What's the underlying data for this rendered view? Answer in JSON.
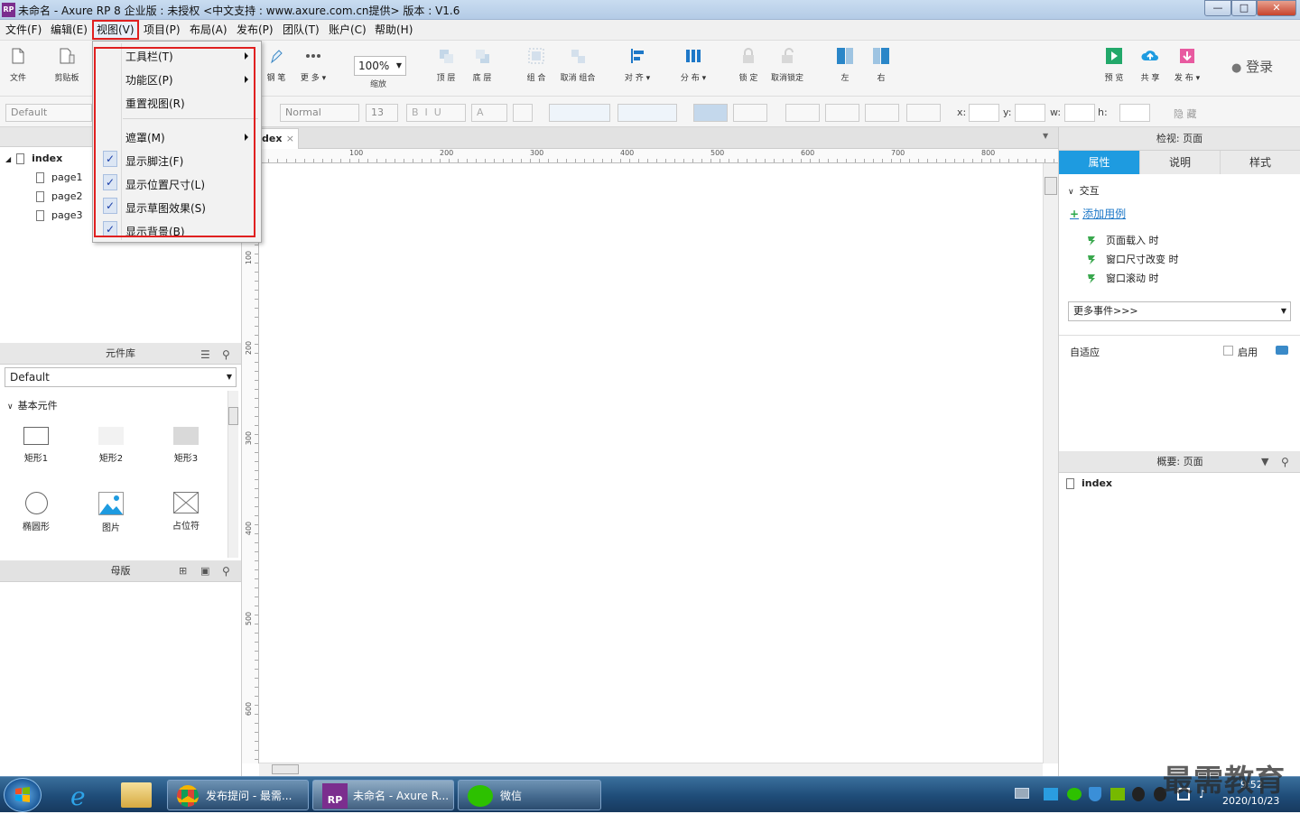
{
  "window": {
    "title": "未命名 - Axure RP 8 企业版 : 未授权      <中文支持 : www.axure.com.cn提供> 版本 : V1.6",
    "app_icon": "RP"
  },
  "menubar": [
    {
      "label": "文件(F)"
    },
    {
      "label": "编辑(E)"
    },
    {
      "label": "视图(V)"
    },
    {
      "label": "项目(P)"
    },
    {
      "label": "布局(A)"
    },
    {
      "label": "发布(P)"
    },
    {
      "label": "团队(T)"
    },
    {
      "label": "账户(C)"
    },
    {
      "label": "帮助(H)"
    }
  ],
  "view_menu": {
    "items": [
      {
        "label": "工具栏(T)",
        "checked": false,
        "submenu": true
      },
      {
        "label": "功能区(P)",
        "checked": false,
        "submenu": true
      },
      {
        "label": "重置视图(R)",
        "checked": false,
        "submenu": false
      },
      {
        "label": "遮罩(M)",
        "checked": false,
        "submenu": true
      },
      {
        "label": "显示脚注(F)",
        "checked": true,
        "submenu": false
      },
      {
        "label": "显示位置尺寸(L)",
        "checked": true,
        "submenu": false
      },
      {
        "label": "显示草图效果(S)",
        "checked": true,
        "submenu": false
      },
      {
        "label": "显示背景(B)",
        "checked": true,
        "submenu": false
      }
    ],
    "check_glyph": "✓"
  },
  "toolbar": {
    "file": "文件",
    "clipboard": "剪贴板",
    "pen": "钢 笔",
    "more": "更 多 ▾",
    "zoom_value": "100%",
    "zoom_label": "缩放",
    "top": "顶 层",
    "bottom": "底 层",
    "group": "组 合",
    "ungroup": "取消 组合",
    "align": "对 齐 ▾",
    "distribute": "分 布 ▾",
    "lock": "锁 定",
    "unlock": "取消锁定",
    "left": "左",
    "right": "右",
    "preview": "预 览",
    "share": "共 享",
    "publish": "发 布 ▾",
    "login": "登录"
  },
  "formatbar": {
    "style": "Default",
    "font_style": "Normal",
    "font_size": "13",
    "x_label": "x:",
    "y_label": "y:",
    "w_label": "w:",
    "h_label": "h:",
    "hide": "隐 藏"
  },
  "pages_panel": {
    "pages": [
      {
        "label": "index"
      },
      {
        "label": "page1"
      },
      {
        "label": "page2"
      },
      {
        "label": "page3"
      }
    ]
  },
  "widgets_panel": {
    "title": "元件库",
    "library": "Default",
    "section": "基本元件",
    "items": [
      {
        "label": "矩形1"
      },
      {
        "label": "矩形2"
      },
      {
        "label": "矩形3"
      },
      {
        "label": "椭圆形"
      },
      {
        "label": "图片"
      },
      {
        "label": "占位符"
      }
    ]
  },
  "masters_panel": {
    "title": "母版"
  },
  "canvas": {
    "tab": "dex",
    "ruler_h": [
      "100",
      "200",
      "300",
      "400",
      "500",
      "600",
      "700",
      "800"
    ],
    "ruler_v": [
      "100",
      "200",
      "300",
      "400",
      "500",
      "600"
    ]
  },
  "inspector": {
    "title": "检视: 页面",
    "tabs": [
      "属性",
      "说明",
      "样式"
    ],
    "interaction": "交互",
    "add_case": "添加用例",
    "events": [
      "页面载入 时",
      "窗口尺寸改变 时",
      "窗口滚动 时"
    ],
    "more_events": "更多事件>>>",
    "adaptive": "自适应",
    "enable": "启用"
  },
  "outline": {
    "title": "概要: 页面",
    "root": "index"
  },
  "taskbar": {
    "tasks": [
      {
        "label": "发布提问 - 最需..."
      },
      {
        "label": "未命名 - Axure R..."
      },
      {
        "label": "微信"
      }
    ],
    "time": "9:52",
    "date": "2020/10/23"
  },
  "watermark": "最需教育",
  "colors": {
    "accent": "#1e9be0",
    "highlight": "#e02020",
    "taskbar": "#1f4c78"
  }
}
